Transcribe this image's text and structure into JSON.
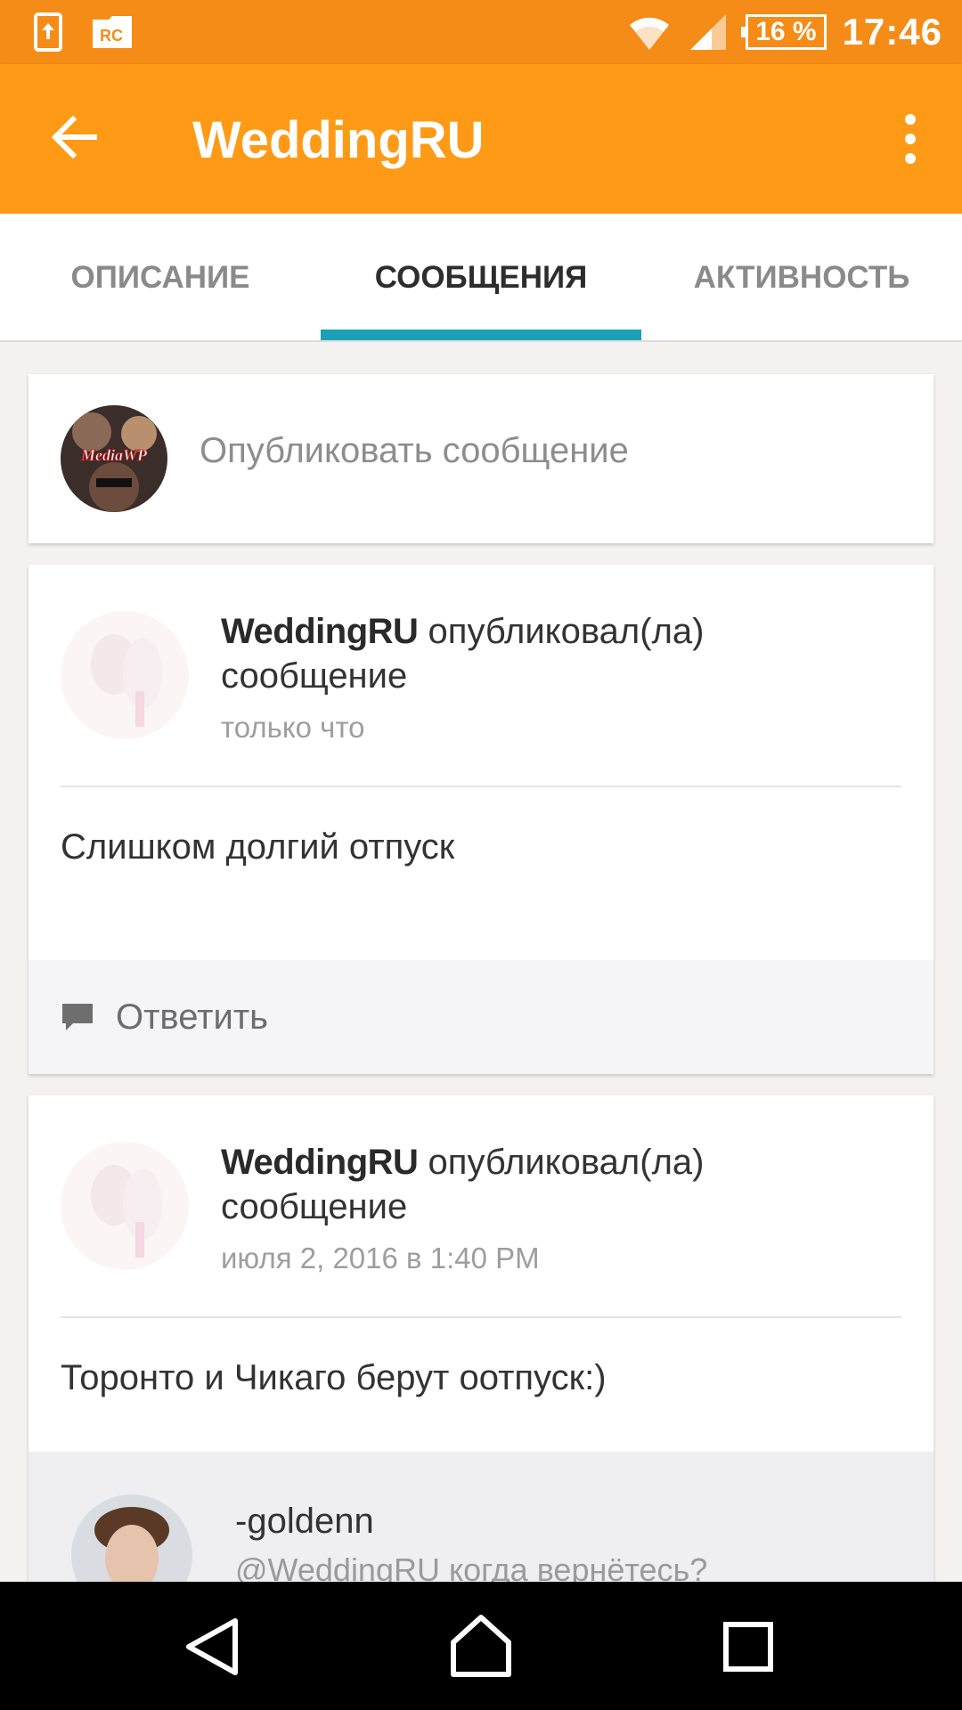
{
  "status_bar": {
    "left_icons": [
      "upload-icon",
      "rc-icon"
    ],
    "wifi_icon": "wifi-icon",
    "signal_icon": "signal-icon",
    "battery": "16 %",
    "time": "17:46"
  },
  "app_bar": {
    "title": "WeddingRU",
    "back_icon": "arrow-left-icon",
    "menu_icon": "more-vertical-icon",
    "color": "#ff9a16"
  },
  "tabs": [
    {
      "label": "ОПИСАНИЕ",
      "active": false
    },
    {
      "label": "СООБЩЕНИЯ",
      "active": true
    },
    {
      "label": "АКТИВНОСТЬ",
      "active": false
    }
  ],
  "accent": "#1aa1b5",
  "composer": {
    "avatar_text": "MediaWP",
    "placeholder": "Опубликовать сообщение"
  },
  "posts": [
    {
      "author": "WeddingRU",
      "action_line1": "опубликовал(ла)",
      "action_line2": "сообщение",
      "time": "только что",
      "body": "Слишком долгий отпуск",
      "reply_label": "Ответить"
    },
    {
      "author": "WeddingRU",
      "action_line1": "опубликовал(ла)",
      "action_line2": "сообщение",
      "time": "июля 2, 2016 в 1:40 PM",
      "body": "Торонто и Чикаго берут оотпуск:)",
      "comment": {
        "name": "-goldenn",
        "text": "@WeddingRU когда вернётесь?"
      }
    }
  ],
  "nav_bar": {
    "buttons": [
      "back-triangle-icon",
      "home-icon",
      "recents-icon"
    ]
  }
}
